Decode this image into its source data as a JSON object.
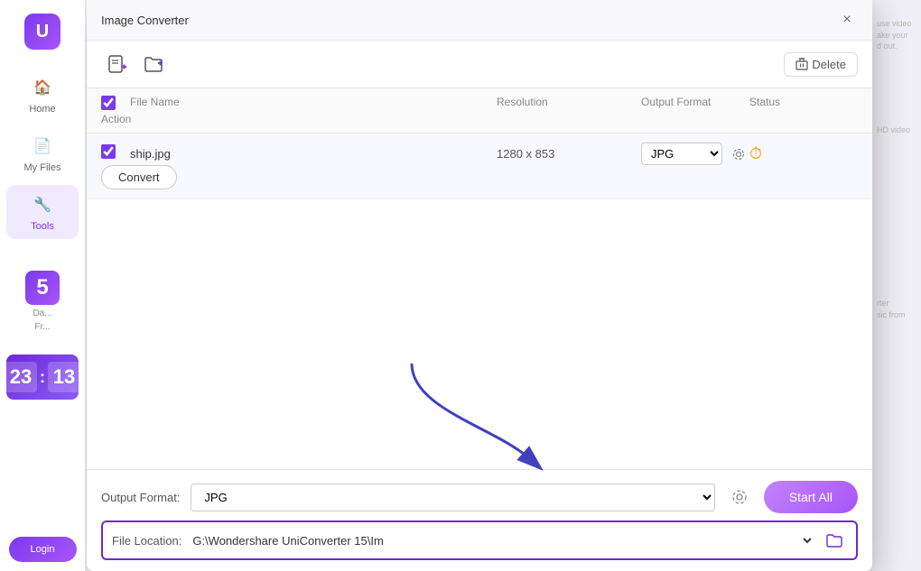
{
  "app": {
    "name": "Wondershare UniConverter"
  },
  "dialog": {
    "title": "Image Converter",
    "close_label": "×",
    "delete_label": "Delete"
  },
  "toolbar": {
    "add_file_icon": "+",
    "add_folder_icon": "📁+"
  },
  "table": {
    "headers": [
      "",
      "File Name",
      "",
      "Resolution",
      "Output Format",
      "Status",
      "Action"
    ],
    "rows": [
      {
        "checked": true,
        "file_name": "ship.jpg",
        "resolution": "1280 x 853",
        "output_format": "JPG",
        "status": "pending",
        "action": "Convert"
      }
    ]
  },
  "footer": {
    "output_format_label": "Output Format:",
    "output_format_value": "JPG",
    "file_location_label": "File Location:",
    "file_location_value": "G:\\Wondershare UniConverter 15\\Im",
    "start_all_label": "Start All"
  },
  "sidebar": {
    "items": [
      {
        "label": "Home",
        "icon": "🏠"
      },
      {
        "label": "My Files",
        "icon": "📄"
      },
      {
        "label": "Tools",
        "icon": "🔧",
        "active": true
      }
    ],
    "login_label": "Login",
    "timer": {
      "hours": "23",
      "minutes": "13"
    },
    "num_badge": "5"
  }
}
